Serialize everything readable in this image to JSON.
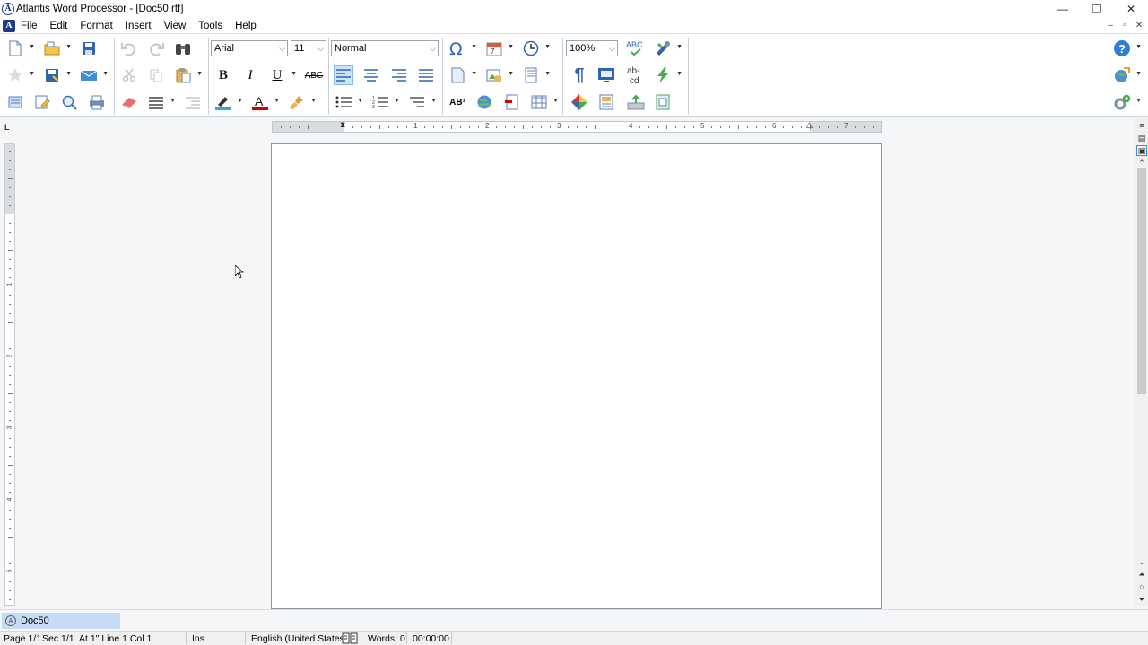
{
  "window": {
    "title": "Atlantis Word Processor - [Doc50.rtf]",
    "logo_letter": "A",
    "minimize": "—",
    "maximize": "❐",
    "close": "✕"
  },
  "menu": {
    "items": [
      "File",
      "Edit",
      "Format",
      "Insert",
      "View",
      "Tools",
      "Help"
    ],
    "mdi": [
      "–",
      "▫",
      "✕"
    ]
  },
  "toolbar": {
    "font_name": "Arial",
    "font_size": "11",
    "style": "Normal",
    "zoom": "100%",
    "bold": "B",
    "italic": "I",
    "underline": "U",
    "strikethrough": "ABC",
    "superscript": "AB¹",
    "spell_check": "ABC",
    "hyphen": "ab-cd",
    "show_marks": "¶"
  },
  "ruler": {
    "corner": "L",
    "numbers": [
      "1",
      "2",
      "3",
      "4",
      "5",
      "6",
      "7"
    ],
    "vnumbers": [
      "1",
      "2",
      "3",
      "4",
      "5"
    ]
  },
  "document_tabs": [
    "Doc50"
  ],
  "status": {
    "page": "Page 1/1",
    "section": "Sec 1/1",
    "position": "At 1\"  Line 1  Col 1",
    "mode": "Ins",
    "language": "English (United States)",
    "words": "Words: 0",
    "time": "00:00:00"
  },
  "colors": {
    "accent": "#1a3a8a",
    "tab_active": "#c6dcf2",
    "highlight": "#2eaadc",
    "font_color": "#d00000"
  }
}
